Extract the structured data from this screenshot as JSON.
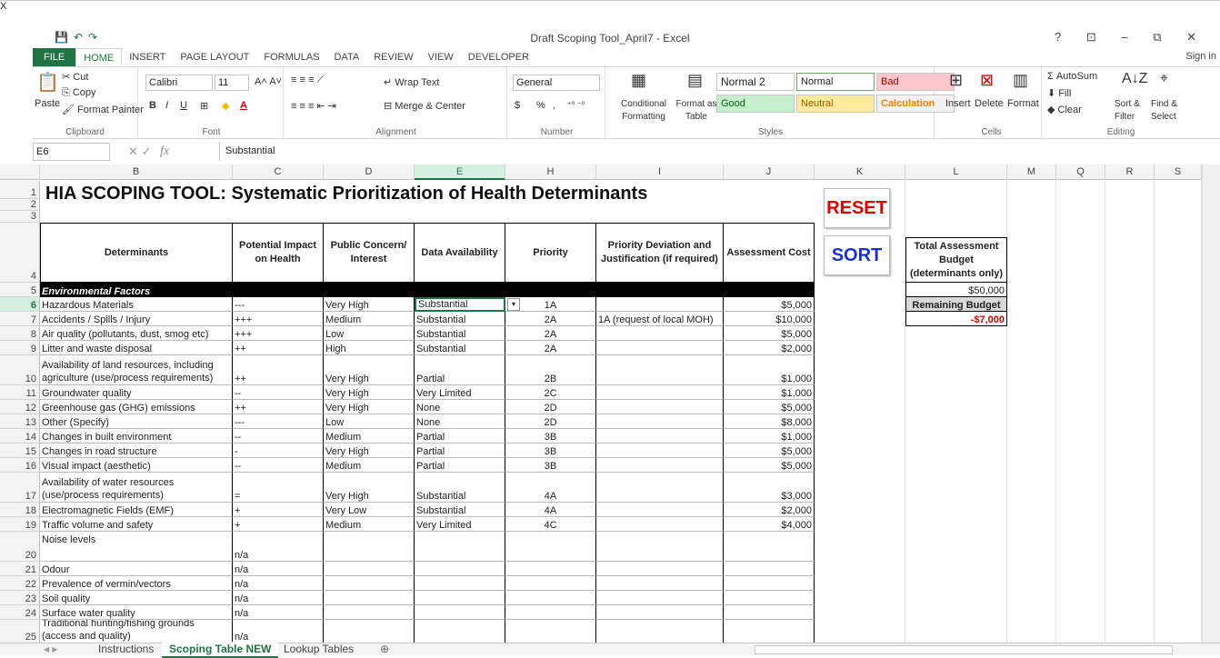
{
  "window": {
    "title": "Draft Scoping Tool_April7 - Excel",
    "controls": "? ⊡ – ⧉ ✕",
    "sign_in": "Sign in",
    "logo": "X"
  },
  "ribbon_tabs": [
    "FILE",
    "HOME",
    "INSERT",
    "PAGE LAYOUT",
    "FORMULAS",
    "DATA",
    "REVIEW",
    "VIEW",
    "DEVELOPER"
  ],
  "clipboard": {
    "paste": "Paste",
    "cut": "Cut",
    "copy": "Copy",
    "format_painter": "Format Painter",
    "label": "Clipboard"
  },
  "font": {
    "name": "Calibri",
    "size": "11",
    "label": "Font",
    "bold": "B",
    "italic": "I",
    "underline": "U"
  },
  "alignment": {
    "wrap_text": "Wrap Text",
    "merge_center": "Merge & Center",
    "label": "Alignment"
  },
  "number": {
    "format": "General",
    "currency": "$",
    "percent": "%",
    "comma": ",",
    "label": "Number"
  },
  "styles": {
    "conditional_formatting": "Conditional Formatting",
    "format_as_table": "Format as Table",
    "normal2": "Normal 2",
    "normal": "Normal",
    "bad": "Bad",
    "good": "Good",
    "neutral": "Neutral",
    "calculation": "Calculation",
    "label": "Styles",
    "colors": {
      "bad_bg": "#ffc7ce",
      "bad_fg": "#9c0006",
      "good_bg": "#c6efce",
      "good_fg": "#006100",
      "neutral_bg": "#ffeb9c",
      "neutral_fg": "#9c5700",
      "calc_bg": "#f2f2f2",
      "calc_fg": "#fa7d00"
    }
  },
  "cells_group": {
    "insert": "Insert",
    "delete": "Delete",
    "format": "Format",
    "label": "Cells"
  },
  "editing": {
    "autosum": "AutoSum",
    "fill": "Fill",
    "clear": "Clear",
    "sort_filter": "Sort & Filter",
    "find_select": "Find & Select",
    "label": "Editing"
  },
  "formula_bar": {
    "name_box": "E6",
    "fx": "fx",
    "content": "Substantial"
  },
  "columns": [
    "B",
    "C",
    "D",
    "E",
    "H",
    "I",
    "J",
    "K",
    "L",
    "M",
    "Q",
    "R",
    "S"
  ],
  "sheet": {
    "title": "HIA SCOPING TOOL: Systematic Prioritization of Health Determinants",
    "headers": {
      "determinants": "Determinants",
      "impact": "Potential Impact on Health",
      "concern": "Public Concern/ Interest",
      "availability": "Data Availability",
      "priority": "Priority",
      "deviation": "Priority Deviation and Justification (if required)",
      "cost": "Assessment Cost"
    },
    "section": "Environmental Factors",
    "rows": [
      {
        "n": "6",
        "det": "Hazardous Materials",
        "imp": "---",
        "con": "Very High",
        "av": "Substantial",
        "pri": "1A",
        "dev": "",
        "cost": "$5,000"
      },
      {
        "n": "7",
        "det": "Accidents / Spills / Injury",
        "imp": "+++",
        "con": "Medium",
        "av": "Substantial",
        "pri": "2A",
        "dev": "1A (request of local MOH)",
        "cost": "$10,000"
      },
      {
        "n": "8",
        "det": "Air quality (pollutants, dust, smog etc)",
        "imp": "+++",
        "con": "Low",
        "av": "Substantial",
        "pri": "2A",
        "dev": "",
        "cost": "$5,000"
      },
      {
        "n": "9",
        "det": "Litter and waste disposal",
        "imp": "++",
        "con": "High",
        "av": "Substantial",
        "pri": "2A",
        "dev": "",
        "cost": "$2,000"
      },
      {
        "n": "10",
        "det": "Availability of land resources, including agriculture (use/process requirements)",
        "imp": "++",
        "con": "Very High",
        "av": "Partial",
        "pri": "2B",
        "dev": "",
        "cost": "$1,000"
      },
      {
        "n": "11",
        "det": "Groundwater quality",
        "imp": "--",
        "con": "Very High",
        "av": "Very Limited",
        "pri": "2C",
        "dev": "",
        "cost": "$1,000"
      },
      {
        "n": "12",
        "det": "Greenhouse gas (GHG) emissions",
        "imp": "++",
        "con": "Very High",
        "av": "None",
        "pri": "2D",
        "dev": "",
        "cost": "$5,000"
      },
      {
        "n": "13",
        "det": "Other (Specify)",
        "imp": "---",
        "con": "Low",
        "av": "None",
        "pri": "2D",
        "dev": "",
        "cost": "$8,000"
      },
      {
        "n": "14",
        "det": "Changes in built environment",
        "imp": "--",
        "con": "Medium",
        "av": "Partial",
        "pri": "3B",
        "dev": "",
        "cost": "$1,000"
      },
      {
        "n": "15",
        "det": "Changes in road structure",
        "imp": "-",
        "con": "Very High",
        "av": "Partial",
        "pri": "3B",
        "dev": "",
        "cost": "$5,000"
      },
      {
        "n": "16",
        "det": "Visual impact (aesthetic)",
        "imp": "--",
        "con": "Medium",
        "av": "Partial",
        "pri": "3B",
        "dev": "",
        "cost": "$5,000"
      },
      {
        "n": "17",
        "det": "Availability of water resources (use/process requirements)",
        "imp": "=",
        "con": "Very High",
        "av": "Substantial",
        "pri": "4A",
        "dev": "",
        "cost": "$3,000"
      },
      {
        "n": "18",
        "det": "Electromagnetic Fields (EMF)",
        "imp": "+",
        "con": "Very Low",
        "av": "Substantial",
        "pri": "4A",
        "dev": "",
        "cost": "$2,000"
      },
      {
        "n": "19",
        "det": "Traffic volume and safety",
        "imp": "+",
        "con": "Medium",
        "av": "Very Limited",
        "pri": "4C",
        "dev": "",
        "cost": "$4,000"
      },
      {
        "n": "20",
        "det": "Noise levels",
        "imp": "n/a",
        "con": "",
        "av": "",
        "pri": "",
        "dev": "",
        "cost": ""
      },
      {
        "n": "21",
        "det": "Odour",
        "imp": "n/a",
        "con": "",
        "av": "",
        "pri": "",
        "dev": "",
        "cost": ""
      },
      {
        "n": "22",
        "det": "Prevalence of vermin/vectors",
        "imp": "n/a",
        "con": "",
        "av": "",
        "pri": "",
        "dev": "",
        "cost": ""
      },
      {
        "n": "23",
        "det": "Soil quality",
        "imp": "n/a",
        "con": "",
        "av": "",
        "pri": "",
        "dev": "",
        "cost": ""
      },
      {
        "n": "24",
        "det": "Surface water quality",
        "imp": "n/a",
        "con": "",
        "av": "",
        "pri": "",
        "dev": "",
        "cost": ""
      },
      {
        "n": "25",
        "det": "Traditional hunting/fishing grounds (access and quality)",
        "imp": "n/a",
        "con": "",
        "av": "",
        "pri": "",
        "dev": "",
        "cost": ""
      }
    ],
    "buttons": {
      "reset": "RESET",
      "sort": "SORT"
    },
    "budget": {
      "header": "Total Assessment Budget (determinants only)",
      "total": "$50,000",
      "remaining_label": "Remaining Budget",
      "remaining": "-$7,000"
    }
  },
  "sheet_tabs": [
    "Instructions",
    "Scoping Table NEW",
    "Lookup Tables"
  ],
  "add_sheet": "⊕"
}
